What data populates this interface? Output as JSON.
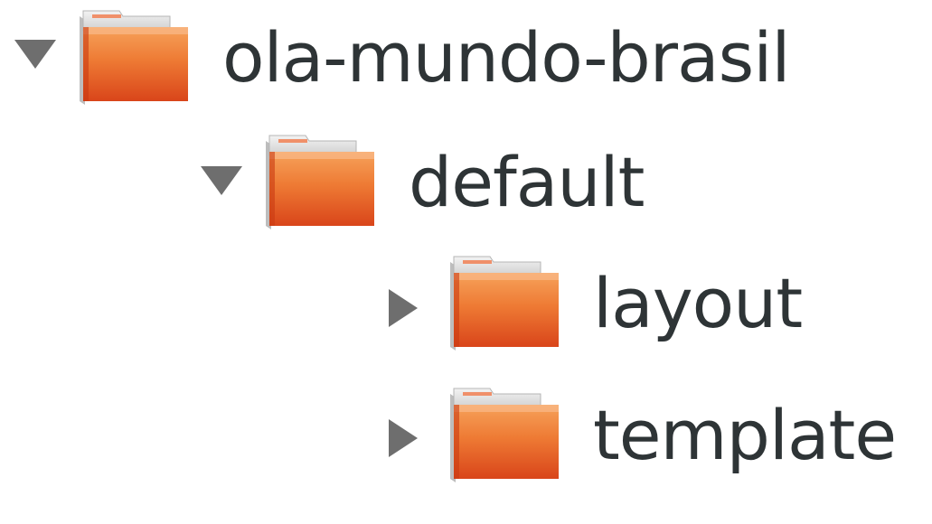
{
  "tree": {
    "nodes": [
      {
        "label": "ola-mundo-brasil",
        "expanded": true,
        "icon": "folder-icon",
        "depth": 0
      },
      {
        "label": "default",
        "expanded": true,
        "icon": "folder-icon",
        "depth": 1
      },
      {
        "label": "layout",
        "expanded": false,
        "icon": "folder-icon",
        "depth": 2
      },
      {
        "label": "template",
        "expanded": false,
        "icon": "folder-icon",
        "depth": 2
      }
    ]
  },
  "colors": {
    "folder_orange": "#e8541a",
    "folder_light": "#f7a35c",
    "expander": "#6e6e6e",
    "text": "#2e3436"
  }
}
